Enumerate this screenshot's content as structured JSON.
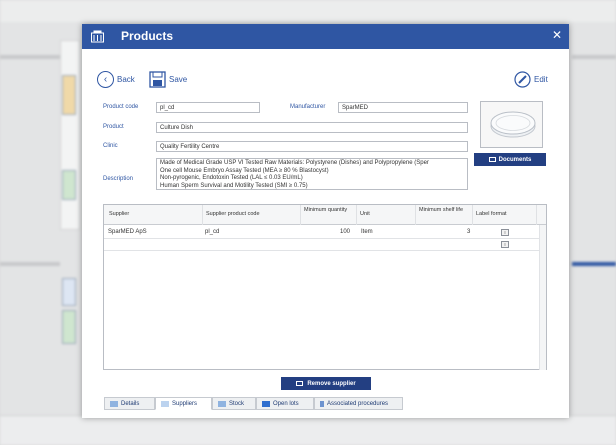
{
  "dialog": {
    "title": "Products",
    "close_glyph": "✕",
    "back_label": "Back",
    "save_label": "Save",
    "edit_label": "Edit"
  },
  "form": {
    "product_code_label": "Product code",
    "product_code_value": "pl_cd",
    "manufacturer_label": "Manufacturer",
    "manufacturer_value": "SparMED",
    "product_label": "Product",
    "product_value": "Culture Dish",
    "clinic_label": "Clinic",
    "clinic_value": "Quality Fertility Centre",
    "description_label": "Description",
    "description_lines": [
      "Made of Medical Grade USP VI Tested Raw Materials: Polystyrene (Dishes) and Polypropylene (Sper",
      "One cell Mouse Embryo Assay Tested (MEA ≥ 80 % Blastocyst)",
      "Non-pyrogenic, Endotoxin Tested (LAL ≤ 0.03 EU/mL)",
      "Human Sperm Survival and Motility Tested (SMI ≥ 0.75)"
    ],
    "documents_label": "Documents"
  },
  "table": {
    "columns": [
      "Supplier",
      "Supplier product code",
      "Minimum quantity",
      "Unit",
      "Minimum shelf life",
      "Label format"
    ],
    "rows": [
      {
        "supplier": "SparMED ApS",
        "code": "pl_cd",
        "min_qty": "100",
        "unit": "Item",
        "shelf_life": "3"
      }
    ]
  },
  "remove_supplier_label": "Remove supplier",
  "tabs": [
    "Details",
    "Suppliers",
    "Stock",
    "Open lots",
    "Associated procedures"
  ],
  "active_tab": "Suppliers",
  "colors": {
    "titlebar": "#2f56a3",
    "button": "#233f82",
    "label": "#2f56a3"
  }
}
